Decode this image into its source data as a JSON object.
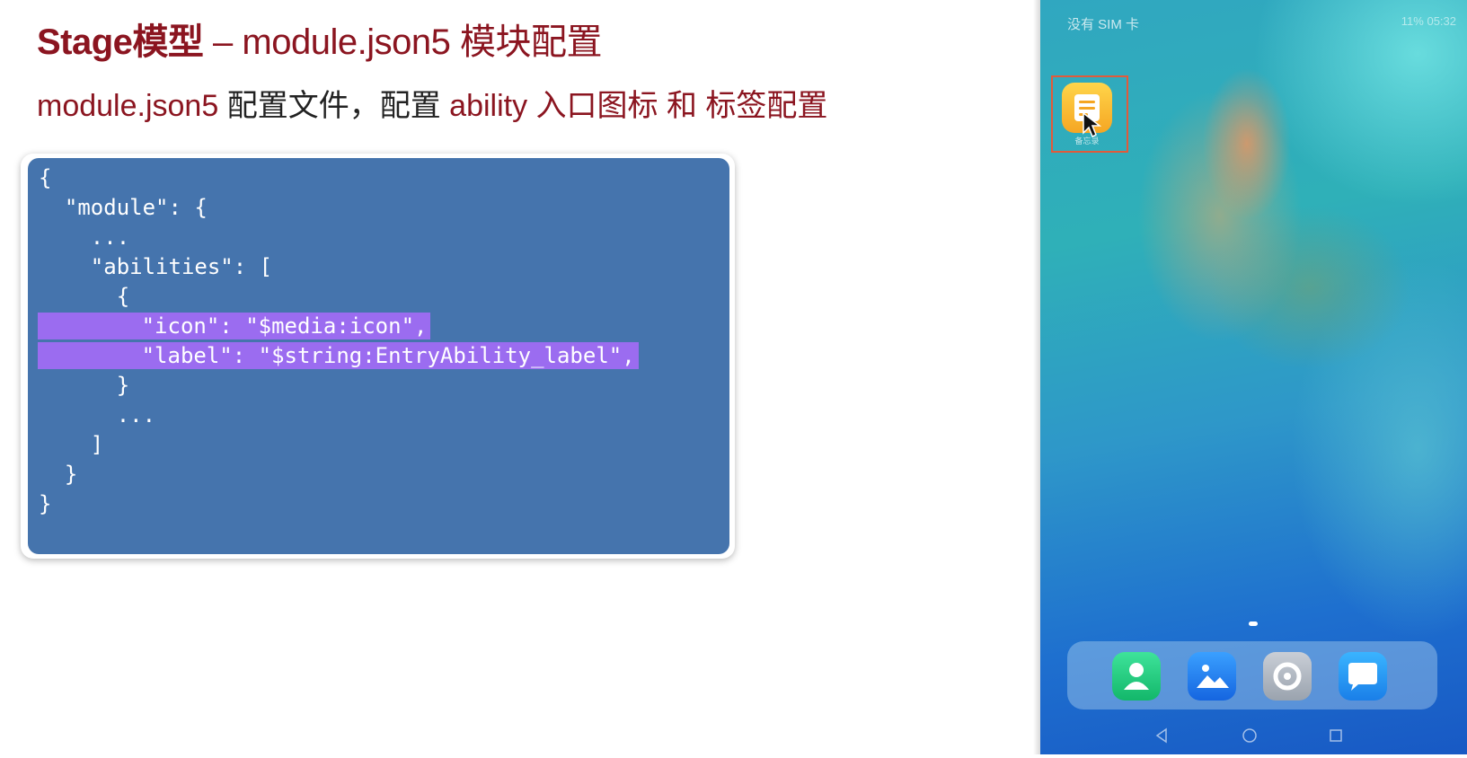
{
  "slide": {
    "title_bold": "Stage模型",
    "title_rest": " – module.json5 模块配置",
    "subtitle": {
      "part1": "module.json5",
      "part2": " 配置文件，配置 ",
      "part3": "ability 入口图标 和 标签配置"
    }
  },
  "code": {
    "lines": [
      "{",
      "  \"module\": {",
      "    ...",
      "    \"abilities\": [",
      "      {",
      "        \"icon\": \"$media:icon\",",
      "        \"label\": \"$string:EntryAbility_label\",",
      "      }",
      "      ...",
      "    ]",
      "  }",
      "}"
    ],
    "highlighted_lines": [
      5,
      6
    ],
    "highlight_color": "#9b6cf0",
    "background_color": "#4574ad"
  },
  "phone": {
    "status_left": "没有 SIM 卡",
    "status_right": "11% 05:32",
    "app_label": "备忘录",
    "highlight_color": "#e25a3a",
    "dock_apps": [
      "contacts-icon",
      "gallery-icon",
      "settings-icon",
      "messages-icon"
    ],
    "nav_buttons": [
      "back-icon",
      "home-icon",
      "recents-icon"
    ]
  }
}
